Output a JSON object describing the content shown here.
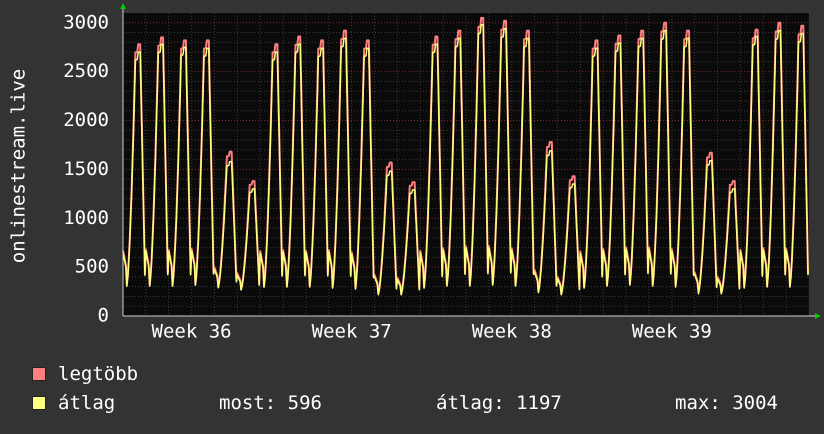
{
  "chart_data": {
    "type": "line",
    "ylabel": "onlinestream.live",
    "ylim": [
      0,
      3100
    ],
    "yticks": [
      0,
      500,
      1000,
      1500,
      2000,
      2500,
      3000
    ],
    "xticks": [
      "Week 36",
      "Week 37",
      "Week 38",
      "Week 39"
    ],
    "grid": true,
    "series": [
      {
        "name": "legtöbb",
        "color": "#ff7f7f",
        "day_peaks": [
          2780,
          2850,
          2820,
          2820,
          1680,
          1380,
          2780,
          2860,
          2820,
          2920,
          2820,
          1570,
          1370,
          2860,
          2920,
          3050,
          3020,
          2920,
          1780,
          1430,
          2820,
          2870,
          2920,
          3000,
          2920,
          1670,
          1380,
          2930,
          3000,
          2970
        ],
        "day_mins": [
          300,
          300,
          300,
          310,
          290,
          270,
          290,
          290,
          290,
          280,
          270,
          220,
          220,
          280,
          300,
          300,
          310,
          300,
          240,
          220,
          280,
          300,
          310,
          300,
          290,
          230,
          230,
          280,
          290,
          290
        ]
      },
      {
        "name": "átlag",
        "color": "#ffff7f",
        "day_peaks": [
          2700,
          2780,
          2750,
          2740,
          1580,
          1300,
          2700,
          2780,
          2740,
          2840,
          2740,
          1480,
          1290,
          2780,
          2840,
          2980,
          2940,
          2840,
          1690,
          1350,
          2740,
          2790,
          2840,
          2920,
          2840,
          1590,
          1300,
          2860,
          2920,
          2890
        ],
        "day_mins": [
          290,
          290,
          290,
          300,
          280,
          260,
          280,
          280,
          280,
          270,
          260,
          210,
          210,
          270,
          290,
          290,
          300,
          290,
          230,
          210,
          270,
          290,
          300,
          290,
          280,
          220,
          220,
          270,
          280,
          280
        ]
      }
    ],
    "legend": [
      {
        "label": "legtöbb",
        "color": "#ff7f7f"
      },
      {
        "label": "átlag",
        "color": "#ffff7f"
      }
    ],
    "stats": {
      "now": "most: 596",
      "avg": "átlag: 1197",
      "max": "max: 3004"
    }
  },
  "colors": {
    "background": "#333333",
    "plot_background": "#0a0a0a",
    "grid_minor": "#3a3a3a",
    "grid_major": "#7a2a2a",
    "axis": "#d0d0d0",
    "arrow": "#00cc00"
  }
}
